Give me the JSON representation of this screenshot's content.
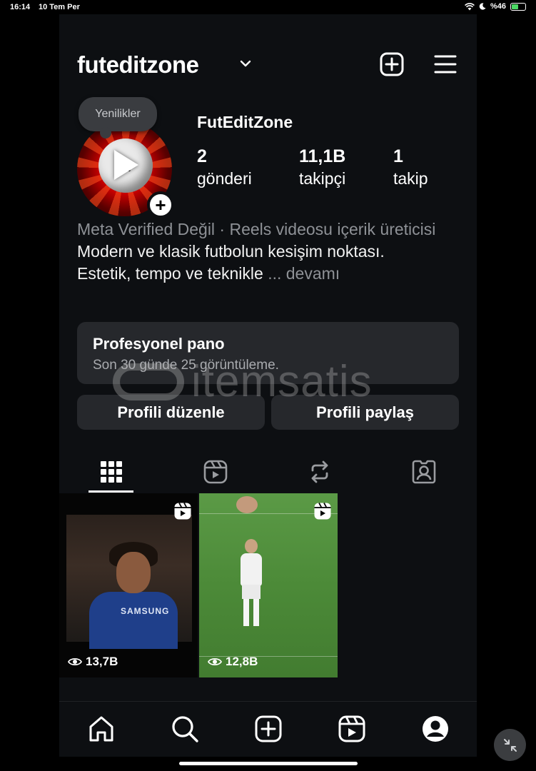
{
  "status_bar": {
    "time": "16:14",
    "date": "10 Tem Per",
    "battery": "%46"
  },
  "header": {
    "username": "futeditzone"
  },
  "profile": {
    "notes_label": "Yenilikler",
    "display_name": "FutEditZone",
    "stats": [
      {
        "value": "2",
        "label": "gönderi"
      },
      {
        "value": "11,1B",
        "label": "takipçi"
      },
      {
        "value": "1",
        "label": "takip"
      }
    ],
    "category": "Meta Verified Değil · Reels videosu içerik üreticisi",
    "bio_line1": "Modern ve klasik futbolun kesişim noktası.",
    "bio_line2": "Estetik, tempo ve teknikle",
    "bio_more": "... devamı"
  },
  "pro_dashboard": {
    "title": "Profesyonel pano",
    "subtitle": "Son 30 günde 25 görüntüleme."
  },
  "actions": {
    "edit_profile": "Profili düzenle",
    "share_profile": "Profili paylaş"
  },
  "tabs": [
    "grid-icon",
    "reels-icon",
    "reposts-icon",
    "tagged-icon"
  ],
  "posts": [
    {
      "views": "13,7B"
    },
    {
      "views": "12,8B"
    }
  ],
  "bottom_nav": [
    "home-icon",
    "search-icon",
    "create-icon",
    "reels-icon",
    "profile-icon"
  ],
  "watermark": {
    "text": "itemsatis"
  }
}
